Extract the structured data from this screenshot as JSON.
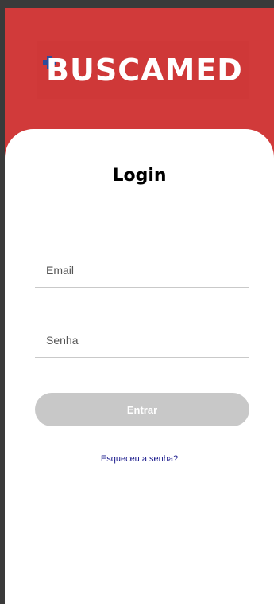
{
  "brand": {
    "logo_text": "BUSCAMED",
    "header_color": "#d13a3a",
    "cross_color": "#2e4b9a"
  },
  "login": {
    "title": "Login",
    "email_placeholder": "Email",
    "password_placeholder": "Senha",
    "submit_label": "Entrar",
    "forgot_link": "Esqueceu a senha?"
  }
}
